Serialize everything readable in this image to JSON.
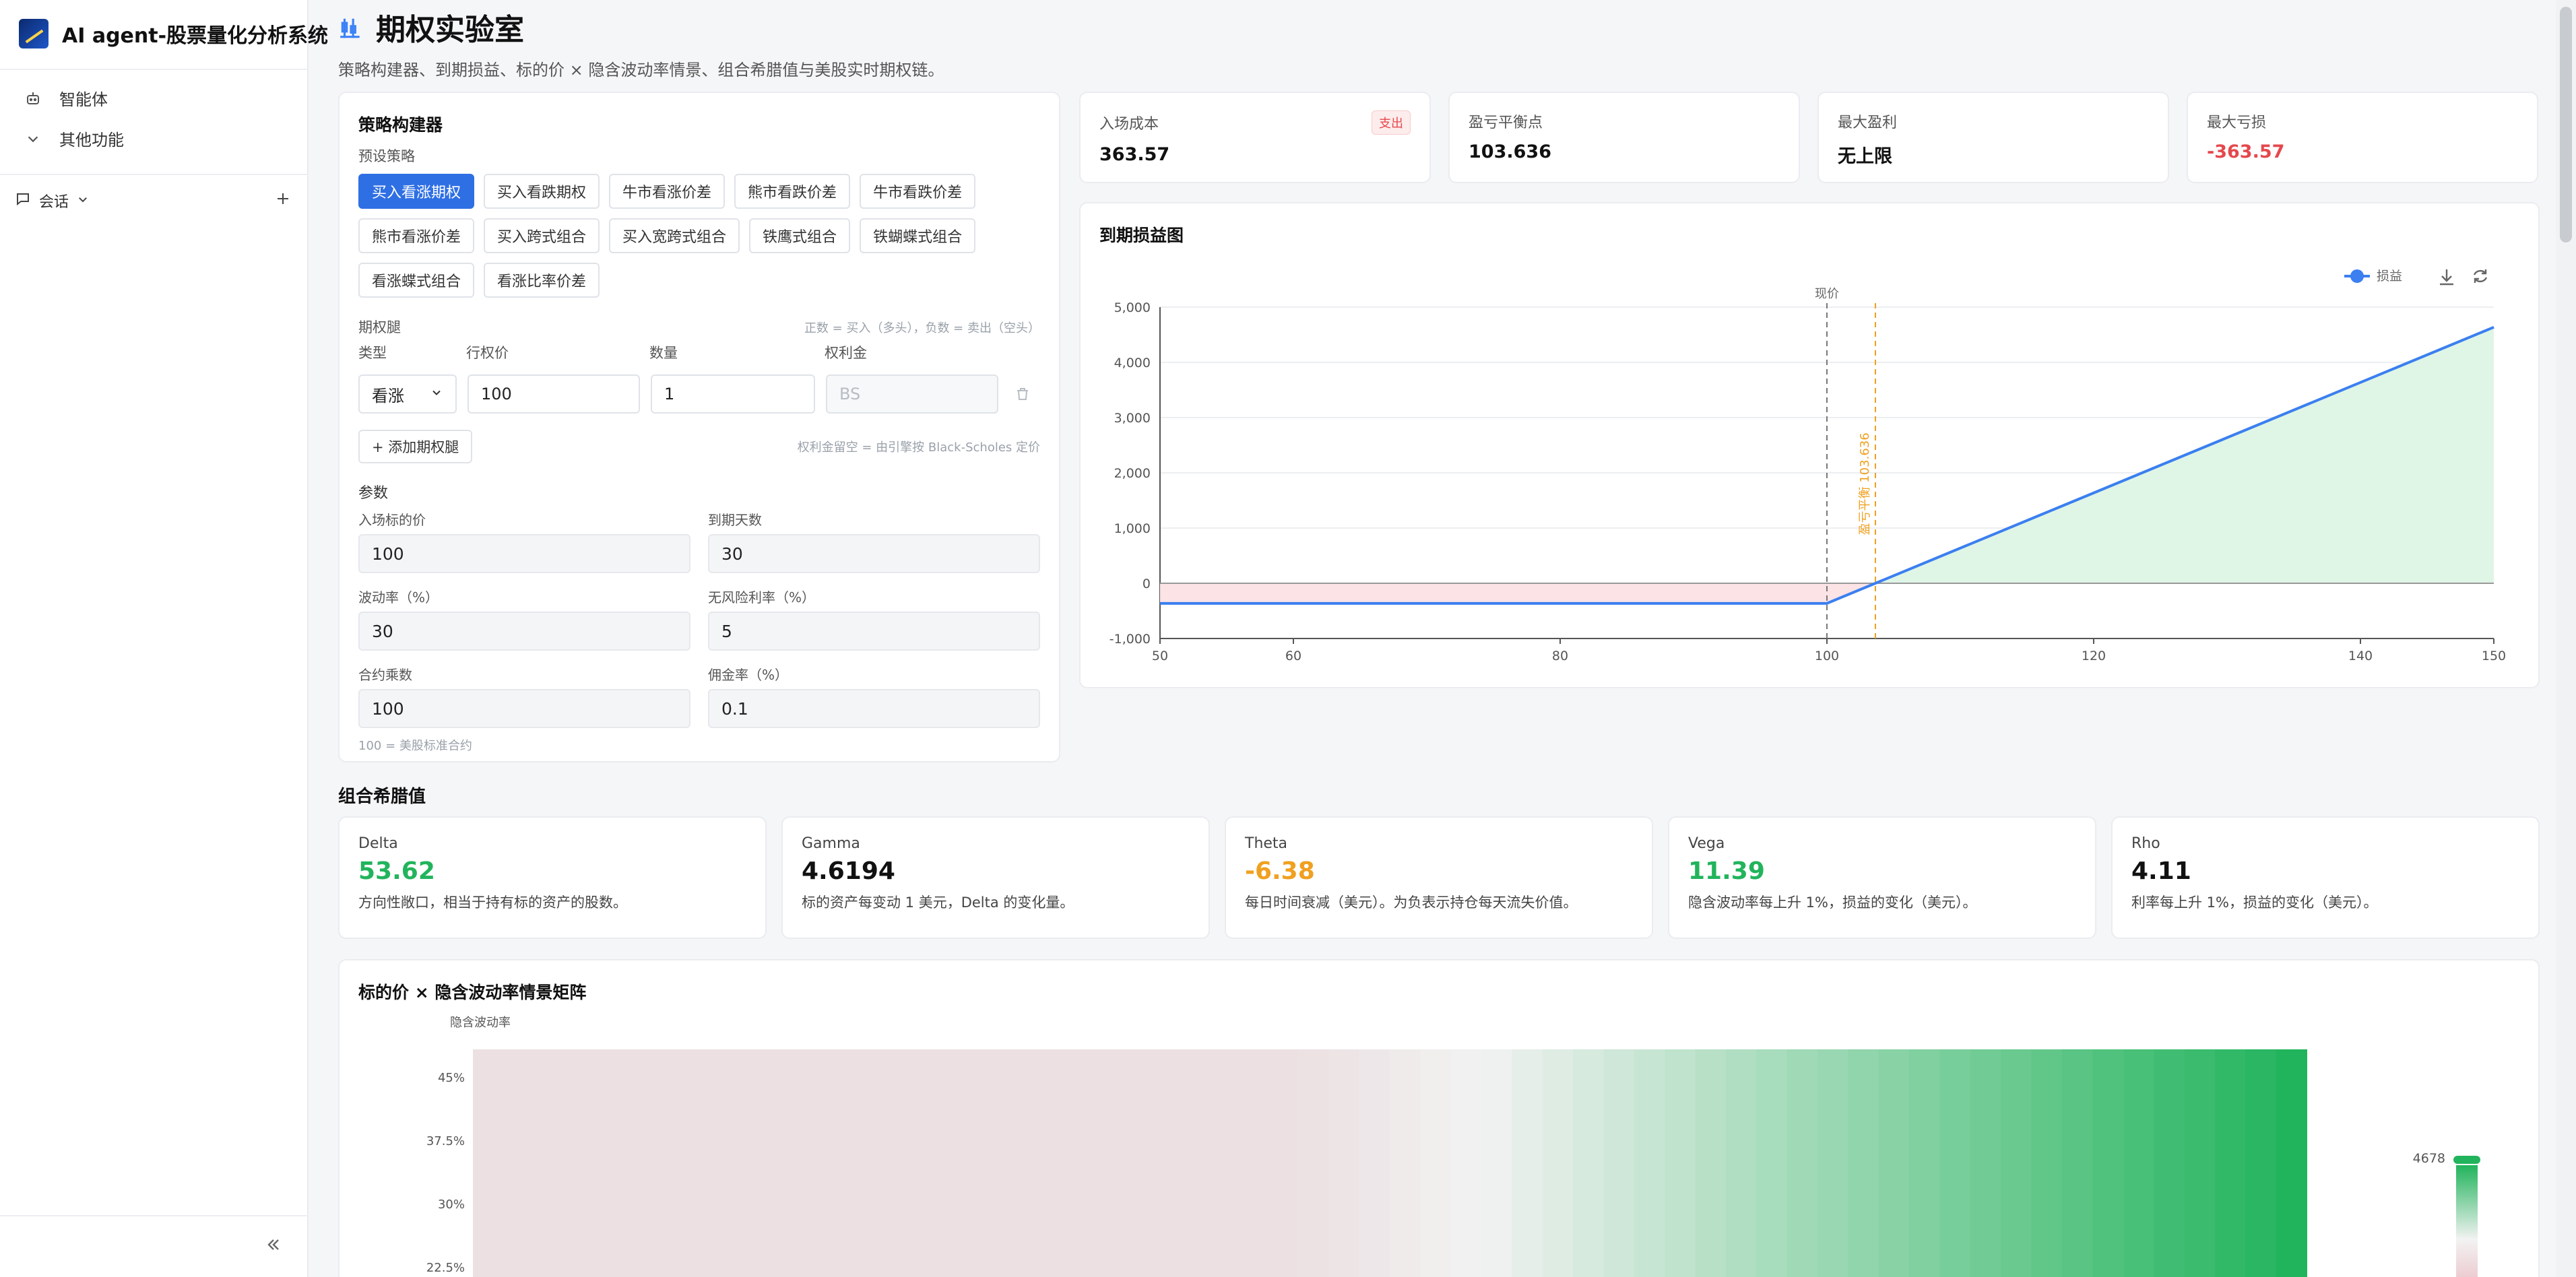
{
  "app": {
    "title": "AI agent-股票量化分析系统"
  },
  "sidebar": {
    "items": [
      {
        "label": "智能体",
        "icon": "robot-icon"
      },
      {
        "label": "其他功能",
        "icon": "chevron-down-icon"
      }
    ],
    "session": {
      "label": "会话"
    }
  },
  "page": {
    "title": "期权实验室",
    "subtitle": "策略构建器、到期损益、标的价 × 隐含波动率情景、组合希腊值与美股实时期权链。"
  },
  "builder": {
    "title": "策略构建器",
    "preset_label": "预设策略",
    "presets": [
      "买入看涨期权",
      "买入看跌期权",
      "牛市看涨价差",
      "熊市看跌价差",
      "牛市看跌价差",
      "熊市看涨价差",
      "买入跨式组合",
      "买入宽跨式组合",
      "铁鹰式组合",
      "铁蝴蝶式组合",
      "看涨蝶式组合",
      "看涨比率价差"
    ],
    "legs_label": "期权腿",
    "legs_hint": "正数 = 买入（多头），负数 = 卖出（空头）",
    "col_type": "类型",
    "col_strike": "行权价",
    "col_qty": "数量",
    "col_premium": "权利金",
    "leg": {
      "type": "看涨",
      "strike": "100",
      "qty": "1",
      "premium_placeholder": "BS"
    },
    "add_leg": "+ 添加期权腿",
    "premium_hint": "权利金留空 = 由引擎按 Black-Scholes 定价",
    "params_label": "参数",
    "params": [
      {
        "label": "入场标的价",
        "value": "100"
      },
      {
        "label": "到期天数",
        "value": "30"
      },
      {
        "label": "波动率（%）",
        "value": "30"
      },
      {
        "label": "无风险利率（%）",
        "value": "5"
      },
      {
        "label": "合约乘数",
        "value": "100"
      },
      {
        "label": "佣金率（%）",
        "value": "0.1"
      }
    ],
    "multiplier_hint": "100 = 美股标准合约"
  },
  "summary": [
    {
      "label": "入场成本",
      "value": "363.57",
      "badge": "支出"
    },
    {
      "label": "盈亏平衡点",
      "value": "103.636"
    },
    {
      "label": "最大盈利",
      "value": "无上限"
    },
    {
      "label": "最大亏损",
      "value": "-363.57"
    }
  ],
  "pl_chart": {
    "title": "到期损益图",
    "spot_label": "现价",
    "breakeven_label": "盈亏平衡 103.636",
    "legend": "损益",
    "chart_data": {
      "type": "line",
      "series": [
        {
          "name": "损益",
          "x": [
            50,
            100,
            103.636,
            150
          ],
          "y": [
            -363.57,
            -363.57,
            0,
            4636.43
          ]
        }
      ],
      "xlim": [
        50,
        150
      ],
      "ylim": [
        -1000,
        5000
      ],
      "x_ticks": [
        50,
        60,
        80,
        100,
        120,
        140,
        150
      ],
      "y_ticks": [
        -1000,
        0,
        1000,
        2000,
        3000,
        4000,
        5000
      ],
      "y_tick_labels": [
        "-1,000",
        "0",
        "1,000",
        "2,000",
        "3,000",
        "4,000",
        "5,000"
      ],
      "spot": 100,
      "breakeven": 103.636,
      "colors": {
        "line": "#3b7ff0",
        "profit_fill": "#dff5e6",
        "loss_fill": "#fbe3e6",
        "breakeven": "#f0a020"
      }
    }
  },
  "greeks": {
    "title": "组合希腊值",
    "items": [
      {
        "name": "Delta",
        "value": "53.62",
        "desc": "方向性敞口，相当于持有标的资产的股数。",
        "tone": "green"
      },
      {
        "name": "Gamma",
        "value": "4.6194",
        "desc": "标的资产每变动 1 美元，Delta 的变化量。",
        "tone": "plain"
      },
      {
        "name": "Theta",
        "value": "-6.38",
        "desc": "每日时间衰减（美元）。为负表示持仓每天流失价值。",
        "tone": "orange"
      },
      {
        "name": "Vega",
        "value": "11.39",
        "desc": "隐含波动率每上升 1%，损益的变化（美元）。",
        "tone": "green"
      },
      {
        "name": "Rho",
        "value": "4.11",
        "desc": "利率每上升 1%，损益的变化（美元）。",
        "tone": "plain"
      }
    ]
  },
  "heatmap": {
    "title": "标的价 × 隐含波动率情景矩阵",
    "y_axis_label": "隐含波动率",
    "chart_data": {
      "type": "heatmap",
      "y_labels": [
        "45%",
        "37.5%",
        "30%",
        "22.5%"
      ],
      "legend_max": "4678",
      "colors": {
        "low": "#ece0e2",
        "mid": "#f2f2f2",
        "high": "#22b45c"
      }
    }
  }
}
